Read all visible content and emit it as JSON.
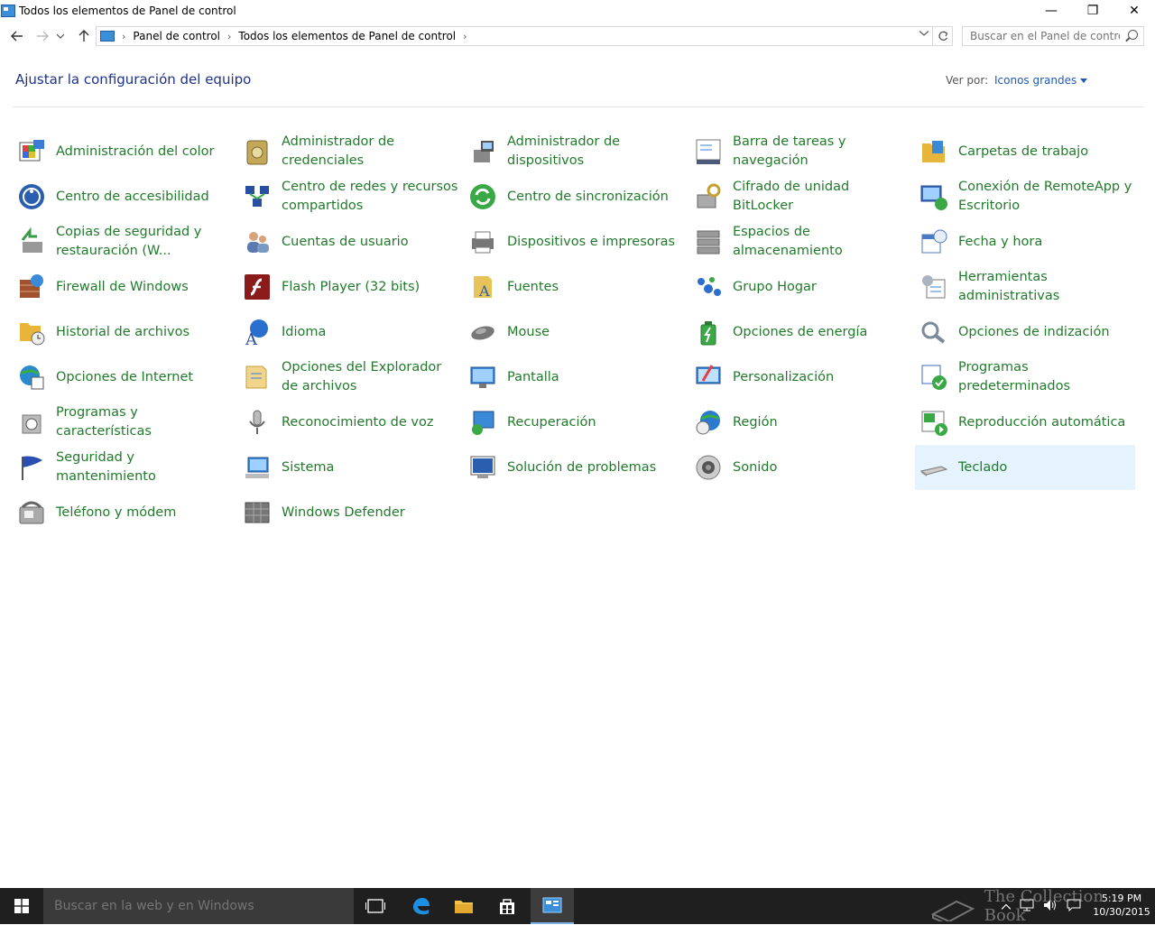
{
  "window": {
    "title": "Todos los elementos de Panel de control",
    "minimize_glyph": "—",
    "maximize_glyph": "❐",
    "close_glyph": "✕"
  },
  "address": {
    "crumbs": [
      "Panel de control",
      "Todos los elementos de Panel de control"
    ],
    "search_placeholder": "Buscar en el Panel de control"
  },
  "header": {
    "title": "Ajustar la configuración del equipo",
    "view_by_label": "Ver por:",
    "view_mode": "Iconos grandes"
  },
  "items": [
    {
      "label": "Administración del color",
      "icon": "color-management-icon",
      "color": "#3b7dd8"
    },
    {
      "label": "Administrador de credenciales",
      "icon": "credential-manager-icon",
      "color": "#b39a4a"
    },
    {
      "label": "Administrador de dispositivos",
      "icon": "device-manager-icon",
      "color": "#6a6a6a"
    },
    {
      "label": "Barra de tareas y navegación",
      "icon": "taskbar-icon",
      "color": "#4a5a78"
    },
    {
      "label": "Carpetas de trabajo",
      "icon": "work-folders-icon",
      "color": "#e7b53c"
    },
    {
      "label": "Centro de accesibilidad",
      "icon": "ease-of-access-icon",
      "color": "#2a5fb0"
    },
    {
      "label": "Centro de redes y recursos compartidos",
      "icon": "network-center-icon",
      "color": "#2a4fa0"
    },
    {
      "label": "Centro de sincronización",
      "icon": "sync-center-icon",
      "color": "#3aa844"
    },
    {
      "label": "Cifrado de unidad BitLocker",
      "icon": "bitlocker-icon",
      "color": "#9a8a5a"
    },
    {
      "label": "Conexión de RemoteApp y Escritorio",
      "icon": "remoteapp-icon",
      "color": "#3b6cc0"
    },
    {
      "label": "Copias de seguridad y restauración (W...",
      "icon": "backup-icon",
      "color": "#3a9a4a"
    },
    {
      "label": "Cuentas de usuario",
      "icon": "user-accounts-icon",
      "color": "#5a7ab0"
    },
    {
      "label": "Dispositivos e impresoras",
      "icon": "devices-printers-icon",
      "color": "#6a6a6a"
    },
    {
      "label": "Espacios de almacenamiento",
      "icon": "storage-spaces-icon",
      "color": "#8a8a8a"
    },
    {
      "label": "Fecha y hora",
      "icon": "date-time-icon",
      "color": "#4a7ac0"
    },
    {
      "label": "Firewall de Windows",
      "icon": "firewall-icon",
      "color": "#a0522d"
    },
    {
      "label": "Flash Player (32 bits)",
      "icon": "flash-player-icon",
      "color": "#8b1a1a"
    },
    {
      "label": "Fuentes",
      "icon": "fonts-icon",
      "color": "#e7b53c"
    },
    {
      "label": "Grupo Hogar",
      "icon": "homegroup-icon",
      "color": "#2a6fd0"
    },
    {
      "label": "Herramientas administrativas",
      "icon": "admin-tools-icon",
      "color": "#8a9aa8"
    },
    {
      "label": "Historial de archivos",
      "icon": "file-history-icon",
      "color": "#e7b53c"
    },
    {
      "label": "Idioma",
      "icon": "language-icon",
      "color": "#2a6fd0"
    },
    {
      "label": "Mouse",
      "icon": "mouse-icon",
      "color": "#6a6a6a"
    },
    {
      "label": "Opciones de energía",
      "icon": "power-options-icon",
      "color": "#3aa844"
    },
    {
      "label": "Opciones de indización",
      "icon": "indexing-icon",
      "color": "#7a8a98"
    },
    {
      "label": "Opciones de Internet",
      "icon": "internet-options-icon",
      "color": "#2a8ad0"
    },
    {
      "label": "Opciones del Explorador de archivos",
      "icon": "folder-options-icon",
      "color": "#e7c45a"
    },
    {
      "label": "Pantalla",
      "icon": "display-icon",
      "color": "#3a8ad8"
    },
    {
      "label": "Personalización",
      "icon": "personalization-icon",
      "color": "#3a8ad8"
    },
    {
      "label": "Programas predeterminados",
      "icon": "default-programs-icon",
      "color": "#3aa844"
    },
    {
      "label": "Programas y características",
      "icon": "programs-features-icon",
      "color": "#8a8a8a"
    },
    {
      "label": "Reconocimiento de voz",
      "icon": "speech-recognition-icon",
      "color": "#8a8a8a"
    },
    {
      "label": "Recuperación",
      "icon": "recovery-icon",
      "color": "#3a8ad8"
    },
    {
      "label": "Región",
      "icon": "region-icon",
      "color": "#2a7ad0"
    },
    {
      "label": "Reproducción automática",
      "icon": "autoplay-icon",
      "color": "#3aa844"
    },
    {
      "label": "Seguridad y mantenimiento",
      "icon": "security-maintenance-icon",
      "color": "#2a4fb0"
    },
    {
      "label": "Sistema",
      "icon": "system-icon",
      "color": "#3a8ad8"
    },
    {
      "label": "Solución de problemas",
      "icon": "troubleshooting-icon",
      "color": "#2a5fb0"
    },
    {
      "label": "Sonido",
      "icon": "sound-icon",
      "color": "#7a7a7a"
    },
    {
      "label": "Teclado",
      "icon": "keyboard-icon",
      "color": "#9a9a9a",
      "selected": true
    },
    {
      "label": "Teléfono y módem",
      "icon": "phone-modem-icon",
      "color": "#8a8a8a"
    },
    {
      "label": "Windows Defender",
      "icon": "windows-defender-icon",
      "color": "#6a6a6a"
    }
  ],
  "taskbar": {
    "search_placeholder": "Buscar en la web y en Windows",
    "time": "5:19 PM",
    "date": "10/30/2015",
    "watermark": "The Collection Book"
  },
  "colors": {
    "link_green": "#217a2b",
    "heading_blue": "#1e3287",
    "selection": "#e5f3ff",
    "taskbar": "#1f1f1f"
  }
}
